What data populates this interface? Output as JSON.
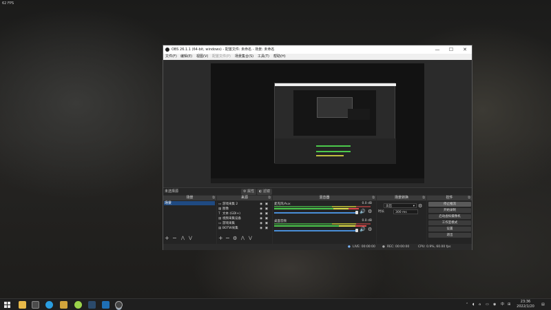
{
  "overlay": {
    "fps": "62 FPS"
  },
  "obs": {
    "title": "OBS 26.1.1 (64-bit, windows) - 配置文件: 未命名 - 场景: 未命名",
    "window_controls": {
      "minimize": "—",
      "maximize": "☐",
      "close": "✕"
    },
    "menu": [
      "文件(F)",
      "编辑(E)",
      "视图(V)",
      "配置文件(P)",
      "场景集合(S)",
      "工具(T)",
      "帮助(H)"
    ],
    "source_bar": {
      "label": "未选择源",
      "properties": "属性",
      "filters": "滤镜"
    },
    "docks": {
      "scenes": {
        "title": "场景",
        "items": [
          "场景"
        ]
      },
      "sources": {
        "title": "来源",
        "items": [
          {
            "icon": "monitor-icon",
            "label": "游戏采集 2"
          },
          {
            "icon": "image-icon",
            "label": "图像"
          },
          {
            "icon": "text-icon",
            "label": "文本 (GDI+)"
          },
          {
            "icon": "window-icon",
            "label": "视频采集设备"
          },
          {
            "icon": "monitor-icon",
            "label": "游戏采集"
          },
          {
            "icon": "window-icon",
            "label": "BOTW采集"
          }
        ]
      },
      "mixer": {
        "title": "混音器",
        "channels": [
          {
            "name": "麦克风/Aux",
            "db": "0.0 dB",
            "level": 0.88
          },
          {
            "name": "桌面音频",
            "db": "0.0 dB",
            "level": 0.96
          }
        ]
      },
      "transitions": {
        "title": "场景转换",
        "type": "淡出",
        "duration_label": "时长",
        "duration_value": "300 ms"
      },
      "controls": {
        "title": "控件",
        "buttons": [
          "停止推流",
          "开始录制",
          "启动虚拟摄像机",
          "工作室模式",
          "设置",
          "退出"
        ]
      }
    },
    "status": {
      "live": "LIVE: 00:00:00",
      "rec": "REC: 00:00:00",
      "cpu": "CPU: 0.9%, 60.00 fps"
    }
  },
  "taskbar": {
    "time": "23:36",
    "date": "2022/1/20",
    "lang": "中",
    "tray_icons": [
      "chevron-up-icon",
      "speaker-icon",
      "network-icon",
      "battery-icon"
    ],
    "apps": [
      "file-explorer-icon",
      "store-icon",
      "edge-icon",
      "game-icon",
      "app-icon",
      "steam-icon",
      "launcher-icon",
      "obs-icon"
    ]
  }
}
